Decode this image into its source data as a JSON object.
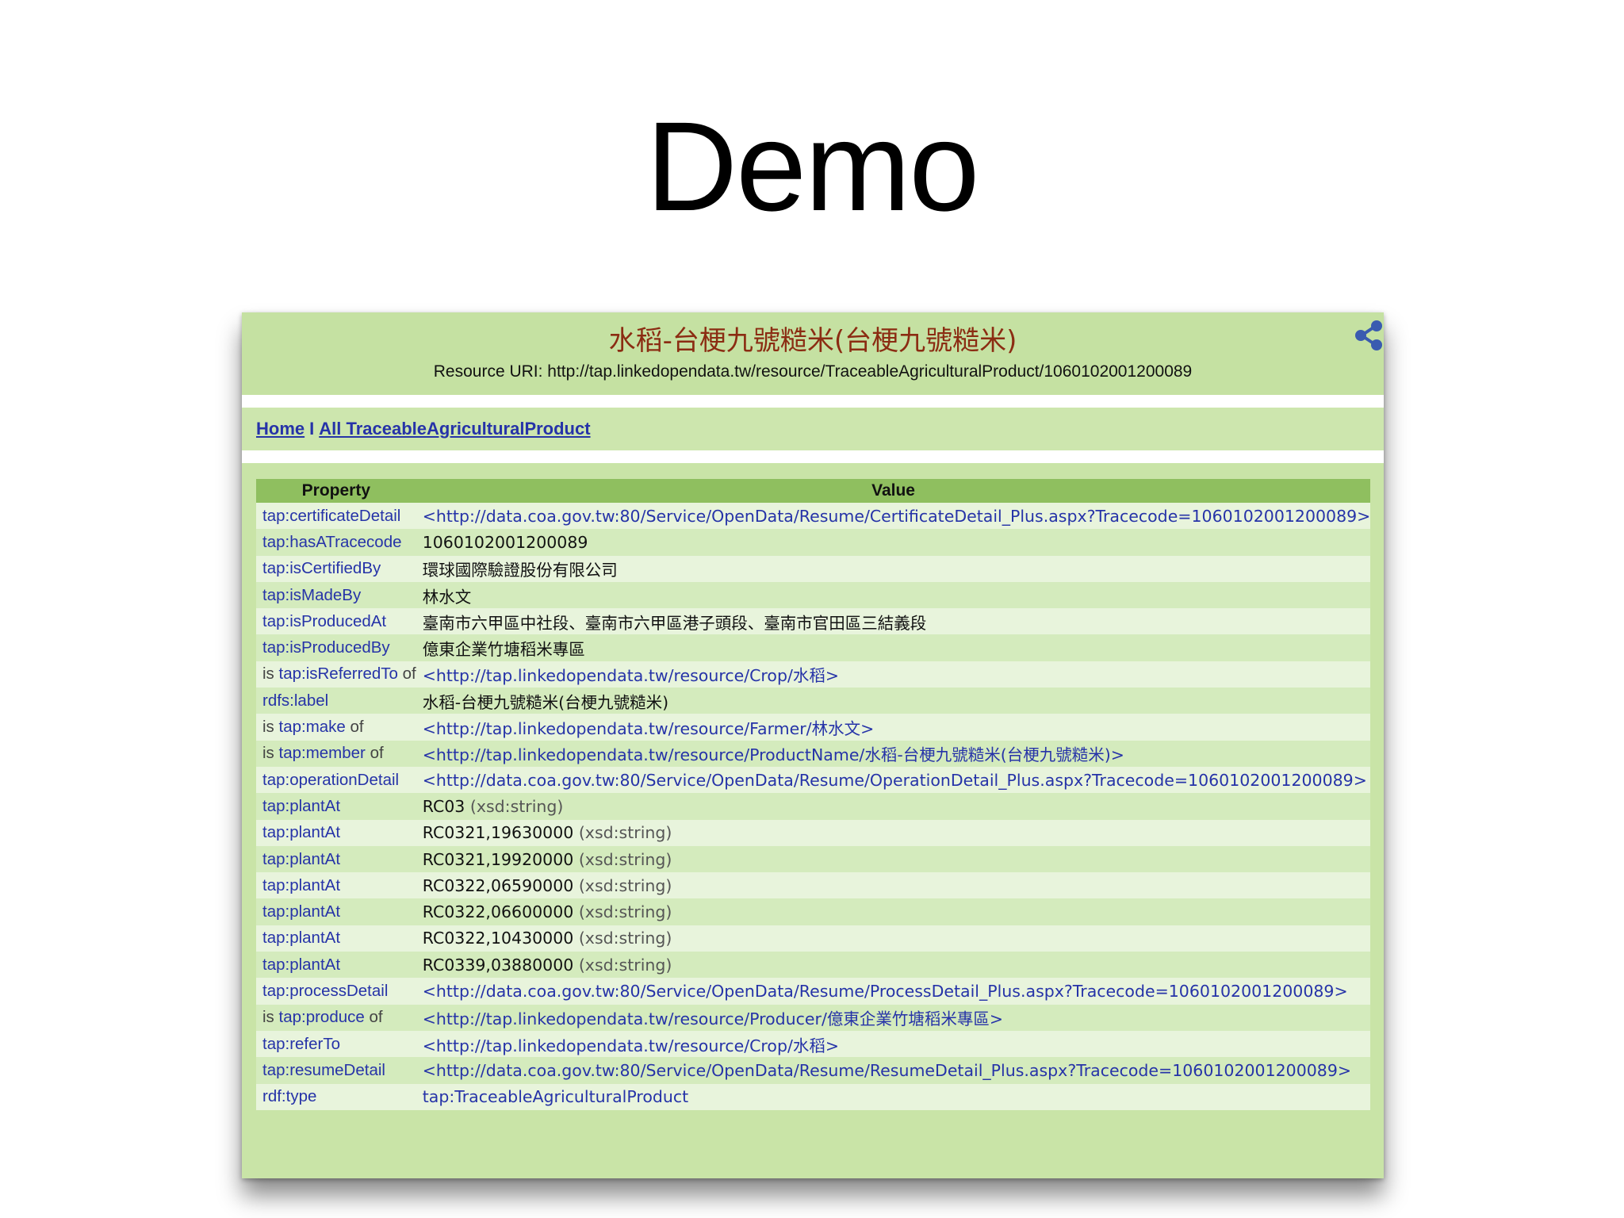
{
  "slide": {
    "title": "Demo"
  },
  "page": {
    "title": "水稻-台梗九號糙米(台梗九號糙米)",
    "uri_label": "Resource URI: ",
    "uri": "http://tap.linkedopendata.tw/resource/TraceableAgriculturalProduct/1060102001200089"
  },
  "nav": {
    "home": "Home",
    "separator": "I",
    "all": "All TraceableAgriculturalProduct"
  },
  "table": {
    "headers": {
      "property": "Property",
      "value": "Value"
    },
    "rows": [
      {
        "pre": "",
        "prop": "tap:certificateDetail",
        "post": "",
        "value": "<http://data.coa.gov.tw:80/Service/OpenData/Resume/CertificateDetail_Plus.aspx?Tracecode=1060102001200089>",
        "link": true,
        "dtype": ""
      },
      {
        "pre": "",
        "prop": "tap:hasATracecode",
        "post": "",
        "value": "1060102001200089",
        "link": false,
        "dtype": ""
      },
      {
        "pre": "",
        "prop": "tap:isCertifiedBy",
        "post": "",
        "value": "環球國際驗證股份有限公司",
        "link": false,
        "dtype": ""
      },
      {
        "pre": "",
        "prop": "tap:isMadeBy",
        "post": "",
        "value": "林水文",
        "link": false,
        "dtype": ""
      },
      {
        "pre": "",
        "prop": "tap:isProducedAt",
        "post": "",
        "value": "臺南市六甲區中社段、臺南市六甲區港子頭段、臺南市官田區三結義段",
        "link": false,
        "dtype": ""
      },
      {
        "pre": "",
        "prop": "tap:isProducedBy",
        "post": "",
        "value": "億東企業竹塘稻米專區",
        "link": false,
        "dtype": ""
      },
      {
        "pre": "is ",
        "prop": "tap:isReferredTo",
        "post": " of",
        "value": "<http://tap.linkedopendata.tw/resource/Crop/水稻>",
        "link": true,
        "dtype": ""
      },
      {
        "pre": "",
        "prop": "rdfs:label",
        "post": "",
        "value": "水稻-台梗九號糙米(台梗九號糙米)",
        "link": false,
        "dtype": ""
      },
      {
        "pre": "is ",
        "prop": "tap:make",
        "post": " of",
        "value": "<http://tap.linkedopendata.tw/resource/Farmer/林水文>",
        "link": true,
        "dtype": ""
      },
      {
        "pre": "is ",
        "prop": "tap:member",
        "post": " of",
        "value": "<http://tap.linkedopendata.tw/resource/ProductName/水稻-台梗九號糙米(台梗九號糙米)>",
        "link": true,
        "dtype": ""
      },
      {
        "pre": "",
        "prop": "tap:operationDetail",
        "post": "",
        "value": "<http://data.coa.gov.tw:80/Service/OpenData/Resume/OperationDetail_Plus.aspx?Tracecode=1060102001200089>",
        "link": true,
        "dtype": ""
      },
      {
        "pre": "",
        "prop": "tap:plantAt",
        "post": "",
        "value": "RC03",
        "link": false,
        "dtype": " (xsd:string)"
      },
      {
        "pre": "",
        "prop": "tap:plantAt",
        "post": "",
        "value": "RC0321,19630000",
        "link": false,
        "dtype": " (xsd:string)"
      },
      {
        "pre": "",
        "prop": "tap:plantAt",
        "post": "",
        "value": "RC0321,19920000",
        "link": false,
        "dtype": " (xsd:string)"
      },
      {
        "pre": "",
        "prop": "tap:plantAt",
        "post": "",
        "value": "RC0322,06590000",
        "link": false,
        "dtype": " (xsd:string)"
      },
      {
        "pre": "",
        "prop": "tap:plantAt",
        "post": "",
        "value": "RC0322,06600000",
        "link": false,
        "dtype": " (xsd:string)"
      },
      {
        "pre": "",
        "prop": "tap:plantAt",
        "post": "",
        "value": "RC0322,10430000",
        "link": false,
        "dtype": " (xsd:string)"
      },
      {
        "pre": "",
        "prop": "tap:plantAt",
        "post": "",
        "value": "RC0339,03880000",
        "link": false,
        "dtype": " (xsd:string)"
      },
      {
        "pre": "",
        "prop": "tap:processDetail",
        "post": "",
        "value": "<http://data.coa.gov.tw:80/Service/OpenData/Resume/ProcessDetail_Plus.aspx?Tracecode=1060102001200089>",
        "link": true,
        "dtype": ""
      },
      {
        "pre": "is ",
        "prop": "tap:produce",
        "post": " of",
        "value": "<http://tap.linkedopendata.tw/resource/Producer/億東企業竹塘稻米專區>",
        "link": true,
        "dtype": ""
      },
      {
        "pre": "",
        "prop": "tap:referTo",
        "post": "",
        "value": "<http://tap.linkedopendata.tw/resource/Crop/水稻>",
        "link": true,
        "dtype": ""
      },
      {
        "pre": "",
        "prop": "tap:resumeDetail",
        "post": "",
        "value": "<http://data.coa.gov.tw:80/Service/OpenData/Resume/ResumeDetail_Plus.aspx?Tracecode=1060102001200089>",
        "link": true,
        "dtype": ""
      },
      {
        "pre": "",
        "prop": "rdf:type",
        "post": "",
        "value": "tap:TraceableAgriculturalProduct",
        "link": true,
        "dtype": ""
      }
    ]
  },
  "icons": {
    "share": "share-icon"
  },
  "colors": {
    "header_bg": "#c5e1a2",
    "title": "#8b2c12",
    "link": "#2633a8",
    "table_header": "#8fbf5f"
  }
}
